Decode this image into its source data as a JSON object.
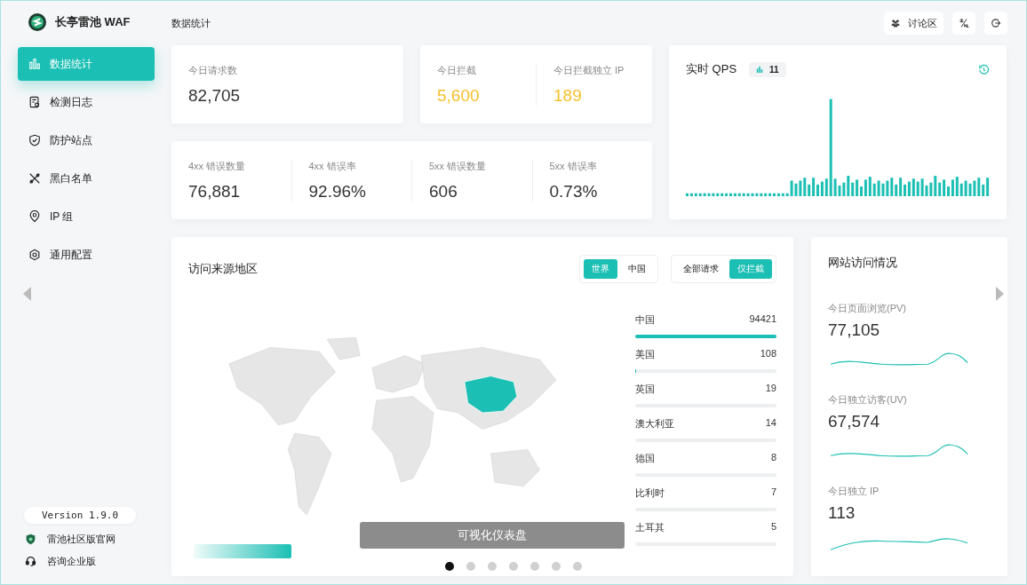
{
  "brand": {
    "name": "长亭雷池 WAF"
  },
  "header": {
    "title": "数据统计",
    "actions": [
      {
        "kind": "community",
        "label": "讨论区"
      },
      {
        "kind": "language"
      },
      {
        "kind": "logout"
      }
    ]
  },
  "sidebar": {
    "items": [
      {
        "kind": "chart",
        "label": "数据统计",
        "selected": true
      },
      {
        "kind": "log",
        "label": "检测日志",
        "selected": false
      },
      {
        "kind": "shield",
        "label": "防护站点",
        "selected": false
      },
      {
        "kind": "tools",
        "label": "黑白名单",
        "selected": false
      },
      {
        "kind": "pin",
        "label": "IP 组",
        "selected": false
      },
      {
        "kind": "gear",
        "label": "通用配置",
        "selected": false
      }
    ],
    "version": "Version 1.9.0",
    "links": [
      {
        "kind": "site",
        "label": "雷池社区版官网"
      },
      {
        "kind": "consult",
        "label": "咨询企业版"
      }
    ]
  },
  "stat_cards": [
    {
      "stats": [
        {
          "label": "今日请求数",
          "value": "82,705",
          "highlight": false
        }
      ]
    },
    {
      "stats": [
        {
          "label": "今日拦截",
          "value": "5,600",
          "highlight": true
        },
        {
          "label": "今日拦截独立 IP",
          "value": "189",
          "highlight": true
        }
      ]
    },
    {
      "stats": [
        {
          "label": "4xx 错误数量",
          "value": "76,881",
          "highlight": false
        },
        {
          "label": "4xx 错误率",
          "value": "92.96%",
          "highlight": false
        },
        {
          "label": "5xx 错误数量",
          "value": "606",
          "highlight": false
        },
        {
          "label": "5xx 错误率",
          "value": "0.73%",
          "highlight": false
        }
      ]
    }
  ],
  "qps": {
    "title": "实时 QPS",
    "badge": "11"
  },
  "regions": {
    "title": "访问来源地区",
    "scope": [
      {
        "label": "世界",
        "selected": true
      },
      {
        "label": "中国",
        "selected": false
      }
    ],
    "filter": [
      {
        "label": "全部请求",
        "selected": false
      },
      {
        "label": "仅拦截",
        "selected": true
      }
    ],
    "rows": [
      {
        "name": "中国",
        "count": "94421",
        "level": 1
      },
      {
        "name": "美国",
        "count": "108",
        "level": 0.001
      },
      {
        "name": "英国",
        "count": "19",
        "level": 0.0002
      },
      {
        "name": "澳大利亚",
        "count": "14",
        "level": 0.00015
      },
      {
        "name": "德国",
        "count": "8",
        "level": 0.0001
      },
      {
        "name": "比利时",
        "count": "7",
        "level": 7e-05
      },
      {
        "name": "土耳其",
        "count": "5",
        "level": 5e-05
      }
    ]
  },
  "traffic": {
    "title": "网站访问情况",
    "metrics": [
      {
        "label": "今日页面浏览(PV)",
        "value": "77,105"
      },
      {
        "label": "今日独立访客(UV)",
        "value": "67,574"
      },
      {
        "label": "今日独立 IP",
        "value": "113"
      }
    ]
  },
  "carousel": {
    "caption": "可视化仪表盘",
    "slides": [
      {
        "selected": true
      },
      {
        "selected": false
      },
      {
        "selected": false
      },
      {
        "selected": false
      },
      {
        "selected": false
      },
      {
        "selected": false
      },
      {
        "selected": false
      }
    ]
  }
}
